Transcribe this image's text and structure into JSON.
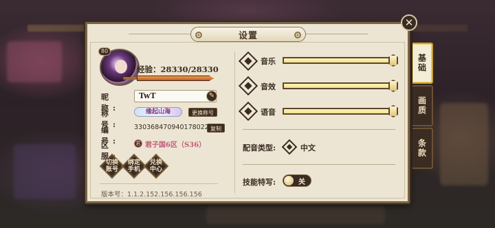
{
  "dialog": {
    "title": "设置",
    "close_symbol": "✕"
  },
  "profile": {
    "level": "80",
    "exp_label": "经验：",
    "exp_value": "28330/28330",
    "exp_fraction": 1.0,
    "nickname_label": "昵　称:",
    "nickname": "TwT",
    "title_label": "称　号:",
    "title_badge": "缘起山海",
    "change_title_button": "更换称号",
    "id_label": "编　号:",
    "id_value": "3303684709401780224",
    "copy_button": "复制",
    "server_label": "区　服:",
    "server_icon_text": "君",
    "server_value": "君子国6区（S36）"
  },
  "actions": [
    {
      "line1": "切换",
      "line2": "账号"
    },
    {
      "line1": "绑定",
      "line2": "手机"
    },
    {
      "line1": "兑换",
      "line2": "中心"
    }
  ],
  "version": "版本号：1.1.2.152.156.156.156",
  "settings": {
    "volumes": [
      {
        "label": "音乐",
        "level": 1.0
      },
      {
        "label": "音效",
        "level": 1.0
      },
      {
        "label": "语音",
        "level": 1.0
      }
    ],
    "dub_type_label": "配音类型:",
    "dub_type_value": "中文",
    "skill_closeup_label": "技能特写:",
    "skill_closeup_state": "关"
  },
  "tabs": [
    {
      "label": "基础",
      "active": true
    },
    {
      "label": "画质",
      "active": false
    },
    {
      "label": "条款",
      "active": false
    }
  ],
  "colors": {
    "panel_bg": "#ece5d3",
    "panel_border": "#7a6446",
    "dark_button": "#3b2c22",
    "slider_fill": "#fbf3b0",
    "exp_fill": "#e07a3a",
    "server_text": "#c45a7a",
    "active_tab_border": "#c9a030"
  }
}
